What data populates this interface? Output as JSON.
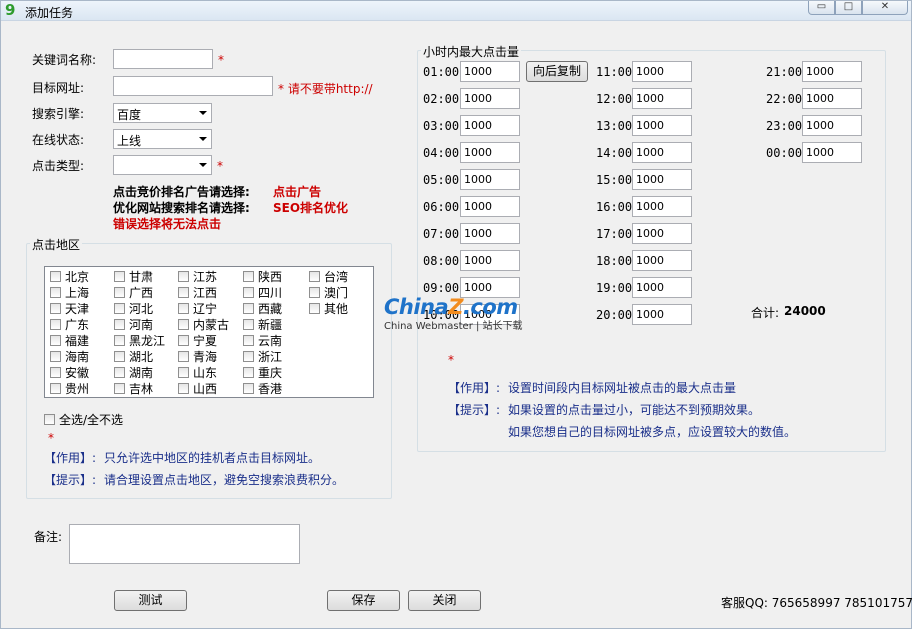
{
  "window": {
    "title": "添加任务",
    "app_icon_glyph": "9",
    "min_glyph": "▭",
    "max_glyph": "□",
    "close_glyph": "✕"
  },
  "form": {
    "keyword_label": "关键词名称:",
    "keyword_value": "",
    "url_label": "目标网址:",
    "url_value": "",
    "url_hint": "* 请不要带http://",
    "engine_label": "搜索引擎:",
    "engine_value": "百度",
    "online_label": "在线状态:",
    "online_value": "上线",
    "click_type_label": "点击类型:",
    "click_type_value": "",
    "required_mark": "*",
    "note1_prefix": "点击竞价排名广告请选择:",
    "note1_value": "点击广告",
    "note2_prefix": "优化网站搜索排名请选择:",
    "note2_value": "SEO排名优化",
    "note3": "错误选择将无法点击"
  },
  "region": {
    "title": "点击地区",
    "items": [
      {
        "name": "北京"
      },
      {
        "name": "甘肃"
      },
      {
        "name": "江苏"
      },
      {
        "name": "陕西"
      },
      {
        "name": "台湾"
      },
      {
        "name": "上海"
      },
      {
        "name": "广西"
      },
      {
        "name": "江西"
      },
      {
        "name": "四川"
      },
      {
        "name": "澳门"
      },
      {
        "name": "天津"
      },
      {
        "name": "河北"
      },
      {
        "name": "辽宁"
      },
      {
        "name": "西藏"
      },
      {
        "name": "其他"
      },
      {
        "name": "广东"
      },
      {
        "name": "河南"
      },
      {
        "name": "内蒙古"
      },
      {
        "name": "新疆"
      },
      {
        "name": "福建"
      },
      {
        "name": "黑龙江"
      },
      {
        "name": "宁夏"
      },
      {
        "name": "云南"
      },
      {
        "name": "海南"
      },
      {
        "name": "湖北"
      },
      {
        "name": "青海"
      },
      {
        "name": "浙江"
      },
      {
        "name": "安徽"
      },
      {
        "name": "湖南"
      },
      {
        "name": "山东"
      },
      {
        "name": "重庆"
      },
      {
        "name": "贵州"
      },
      {
        "name": "吉林"
      },
      {
        "name": "山西"
      },
      {
        "name": "香港"
      }
    ],
    "select_all_label": "全选/全不选",
    "required_mark": "*",
    "usage_tag": "【作用】:",
    "usage_text": "只允许选中地区的挂机者点击目标网址。",
    "tip_tag": "【提示】:",
    "tip_text": "请合理设置点击地区，避免空搜索浪费积分。"
  },
  "hourly": {
    "title": "小时内最大点击量",
    "copy_button": "向后复制",
    "hours": [
      {
        "label": "01:00",
        "value": "1000"
      },
      {
        "label": "02:00",
        "value": "1000"
      },
      {
        "label": "03:00",
        "value": "1000"
      },
      {
        "label": "04:00",
        "value": "1000"
      },
      {
        "label": "05:00",
        "value": "1000"
      },
      {
        "label": "06:00",
        "value": "1000"
      },
      {
        "label": "07:00",
        "value": "1000"
      },
      {
        "label": "08:00",
        "value": "1000"
      },
      {
        "label": "09:00",
        "value": "1000"
      },
      {
        "label": "10:00",
        "value": "1000"
      },
      {
        "label": "11:00",
        "value": "1000"
      },
      {
        "label": "12:00",
        "value": "1000"
      },
      {
        "label": "13:00",
        "value": "1000"
      },
      {
        "label": "14:00",
        "value": "1000"
      },
      {
        "label": "15:00",
        "value": "1000"
      },
      {
        "label": "16:00",
        "value": "1000"
      },
      {
        "label": "17:00",
        "value": "1000"
      },
      {
        "label": "18:00",
        "value": "1000"
      },
      {
        "label": "19:00",
        "value": "1000"
      },
      {
        "label": "20:00",
        "value": "1000"
      },
      {
        "label": "21:00",
        "value": "1000"
      },
      {
        "label": "22:00",
        "value": "1000"
      },
      {
        "label": "23:00",
        "value": "1000"
      },
      {
        "label": "00:00",
        "value": "1000"
      }
    ],
    "total_label": "合计:",
    "total_value": "24000",
    "required_mark": "*",
    "usage_tag": "【作用】:",
    "usage_text": "设置时间段内目标网址被点击的最大点击量",
    "tip_tag": "【提示】:",
    "tip_text1": "如果设置的点击量过小，可能达不到预期效果。",
    "tip_text2": "如果您想自己的目标网址被多点，应设置较大的数值。"
  },
  "notes": {
    "label": "备注:",
    "value": ""
  },
  "footer": {
    "test_button": "测试",
    "save_button": "保存",
    "close_button": "关闭",
    "support": "客服QQ: 765658997 785101757"
  },
  "watermark": {
    "logo_china": "China",
    "logo_z": "Z",
    "logo_com": ".com",
    "subtitle": "China Webmaster | 站长下载"
  },
  "colors": {
    "red": "#cc0000",
    "blue": "#1a2f8a",
    "title_gradient_top": "#eef4fb"
  }
}
